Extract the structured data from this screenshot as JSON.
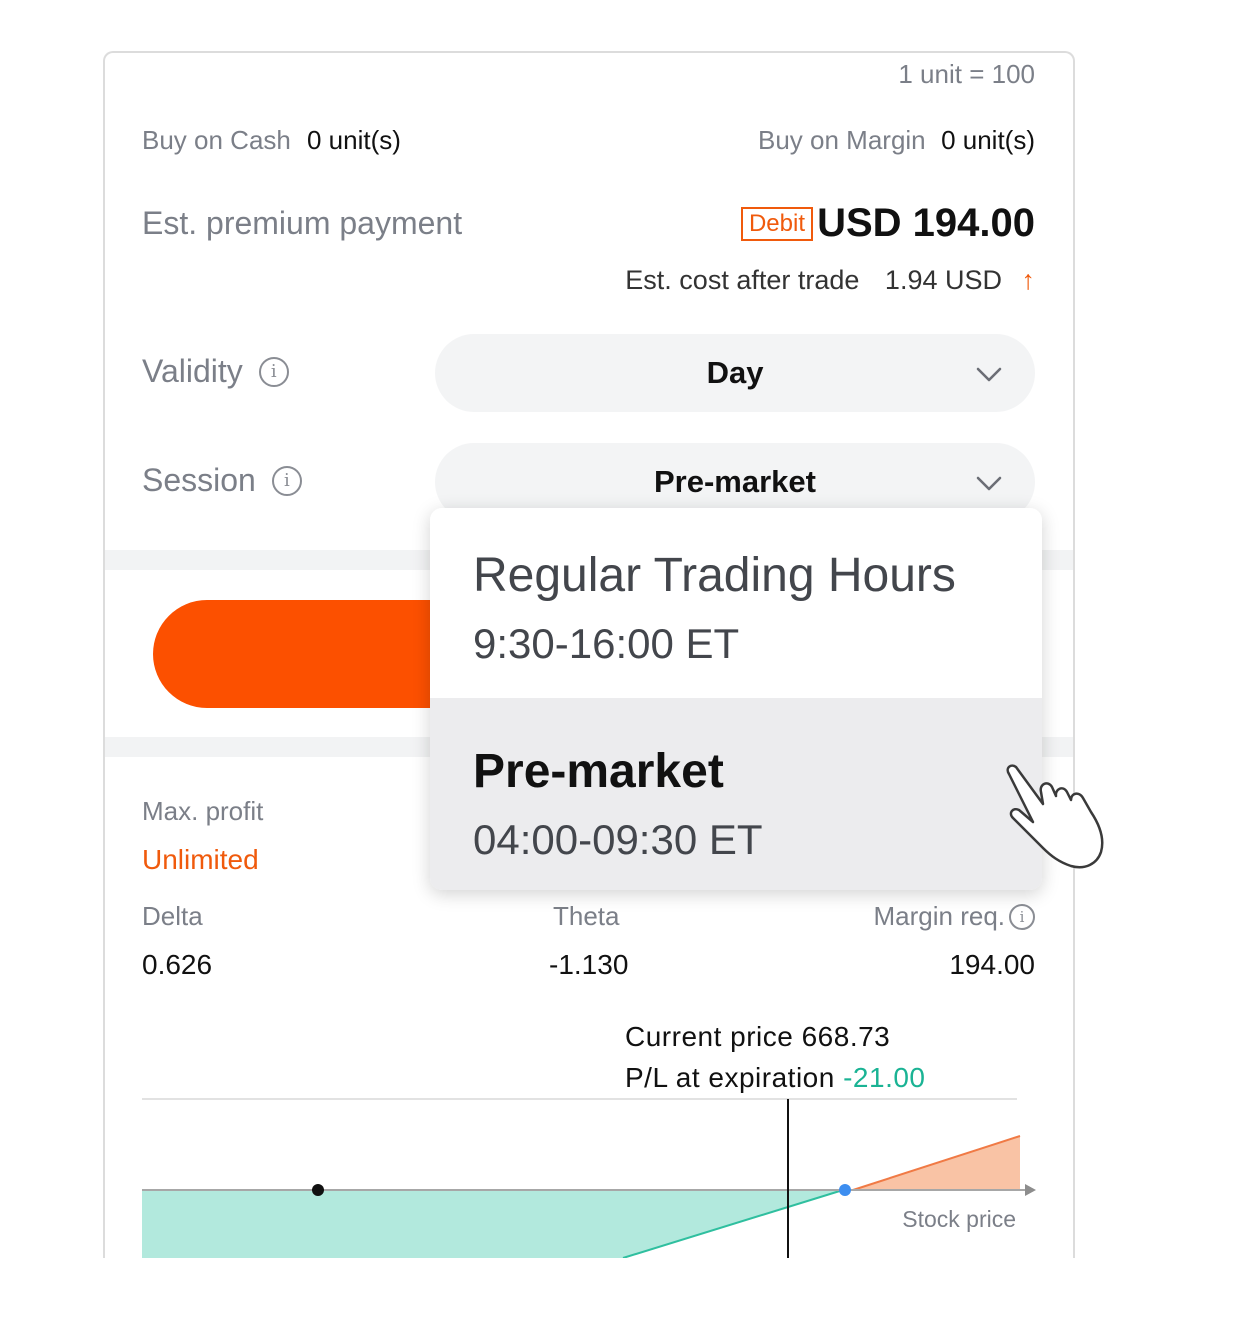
{
  "unit_note": "1 unit = 100",
  "buy_cash": {
    "label": "Buy on Cash",
    "value": "0 unit(s)"
  },
  "buy_margin": {
    "label": "Buy on Margin",
    "value": "0 unit(s)"
  },
  "premium": {
    "label": "Est. premium payment",
    "badge": "Debit",
    "amount": "USD 194.00",
    "cost_label": "Est. cost after trade",
    "cost_value": "1.94 USD",
    "cost_arrow": "↑"
  },
  "validity": {
    "label": "Validity",
    "value": "Day"
  },
  "session": {
    "label": "Session",
    "value": "Pre-market",
    "options": [
      {
        "title": "Regular Trading Hours",
        "time": "9:30-16:00 ET"
      },
      {
        "title": "Pre-market",
        "time": "04:00-09:30 ET"
      }
    ]
  },
  "stats": {
    "max_profit_label": "Max. profit",
    "max_profit_value": "Unlimited",
    "delta_label": "Delta",
    "delta_value": "0.626",
    "theta_label": "Theta",
    "theta_value": "-1.130",
    "margin_label": "Margin req.",
    "margin_value": "194.00"
  },
  "chart": {
    "current_price_label": "Current price 668.73",
    "pl_label": "P/L at expiration",
    "pl_value": "-21.00",
    "axis_label": "Stock price"
  },
  "colors": {
    "accent": "#fc5000",
    "loss_fill": "#b2e9dd",
    "profit_fill": "#f9c3a5",
    "positive_text": "#1ab394"
  }
}
